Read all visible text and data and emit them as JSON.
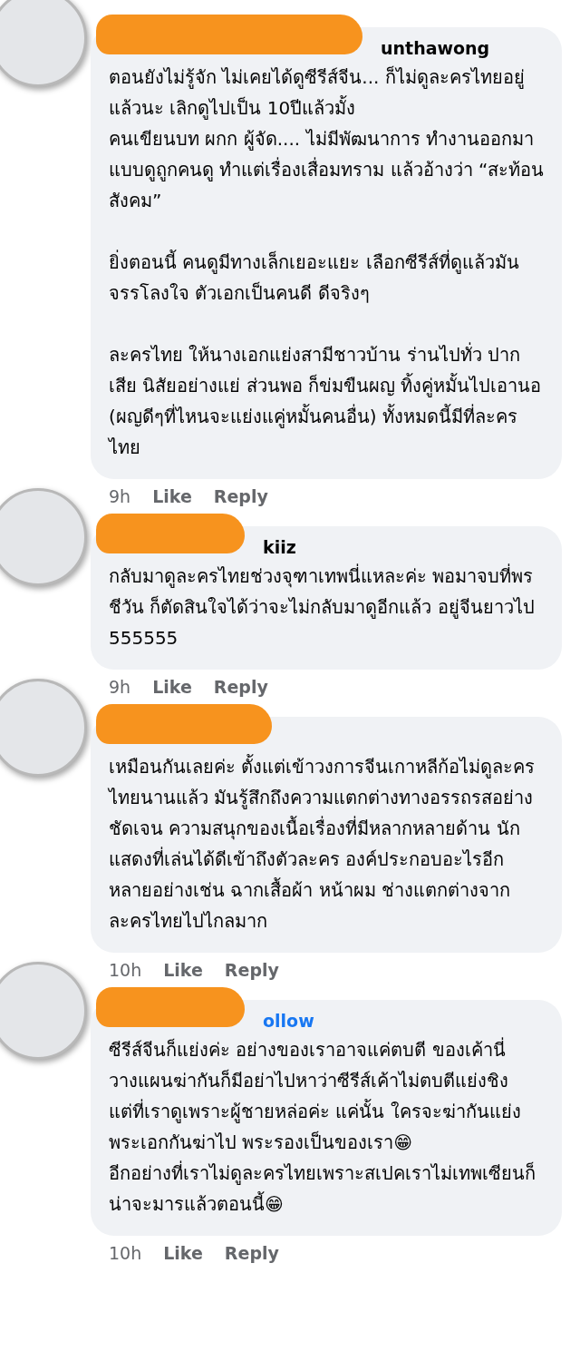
{
  "comments": [
    {
      "name": "unthawong",
      "text": "ตอนยังไม่รู้จัก ไม่เคยได้ดูซีรีส์จีน... ก็ไม่ดูละครไทยอยู่แล้วนะ เลิกดูไปเป็น 10ปีแล้วมั้ง\nคนเขียนบท ผกก ผู้จัด.... ไม่มีพัฒนาการ ทำงานออกมาแบบดูถูกคนดู  ทำแต่เรื่องเสื่อมทราม แล้วอ้างว่า “สะท้อนสังคม”\n\nยิ่งตอนนี้ คนดูมีทางเล็กเยอะแยะ  เลือกซีรีส์ที่ดูแล้วมันจรรโลงใจ ตัวเอกเป็นคนดี ดีจริงๆ\n\nละครไทย ให้นางเอกแย่งสามีชาวบ้าน ร่านไปทั่ว ปากเสีย นิสัยอย่างแย่ ส่วนพอ ก็ข่มขืนผญ  ทิ้งคู่หมั้นไปเอานอ (ผญดีๆที่ไหนจะแย่งแคู่หมั้นคนอื่น) ทั้งหมดนี้มีที่ละครไทย",
      "time": "9h",
      "actions": [
        "Like",
        "Reply"
      ]
    },
    {
      "name": "kiiz",
      "text": "กลับมาดูละครไทยช่วงจุฑาเทพนี่แหละค่ะ  พอมาจบที่พรชีวัน ก็ตัดสินใจได้ว่าจะไม่กลับมาดูอีกแล้ว  อยู่จีนยาวไป 555555",
      "time": "9h",
      "actions": [
        "Like",
        "Reply"
      ]
    },
    {
      "text": "เหมือนกันเลยค่ะ ตั้งแต่เข้าวงการจีนเกาหลีก้อไม่ดูละครไทยนานแล้ว มันรู้สึกถึงความแตกต่างทางอรรถรสอย่างชัดเจน ความสนุกของเนื้อเรื่องที่มีหลากหลายด้าน นักแสดงที่เล่นได้ดีเข้าถึงตัวละคร องค์ประกอบอะไรอีกหลายอย่างเช่น ฉากเสื้อผ้า หน้าผม ช่างแตกต่างจากละครไทยไปไกลมาก",
      "time": "10h",
      "actions": [
        "Like",
        "Reply"
      ]
    },
    {
      "follow": "ollow",
      "text": "ซีรีส์จีนก็แย่งค่ะ อย่างของเราอาจแค่ตบตี ของเค้านี่วางแผนฆ่ากันก็มีอย่าไปหาว่าซีรีส์เค้าไม่ตบตีแย่งชิง\nแต่ที่เราดูเพราะผู้ชายหล่อค่ะ แค่นั้น ใครจะฆ่ากันแย่งพระเอกกันฆ่าไป พระรองเป็นของเรา😁\nอีกอย่างที่เราไม่ดูละครไทยเพราะสเปคเราไม่เทพเซียนก็น่าจะมารแล้วตอนนี้😁",
      "time": "10h",
      "actions": [
        "Like",
        "Reply"
      ]
    }
  ]
}
